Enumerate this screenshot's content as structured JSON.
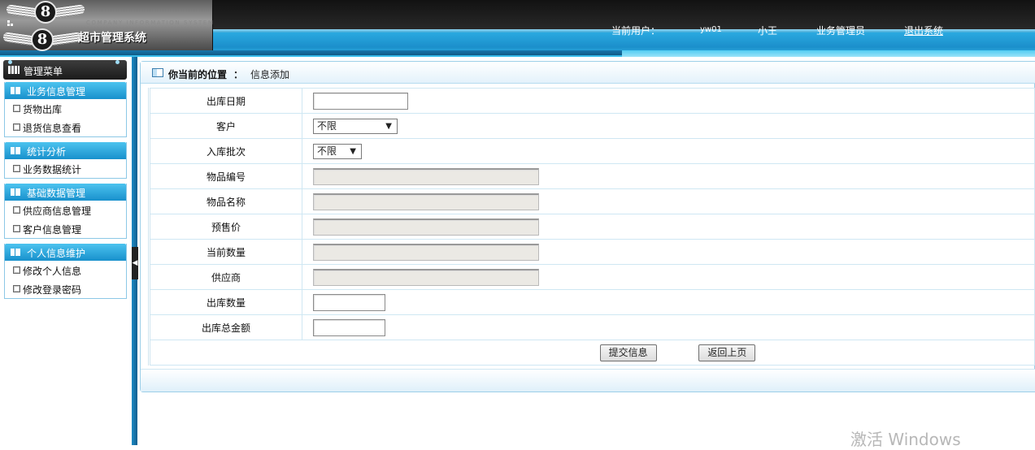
{
  "header": {
    "logo_text": "8",
    "company_en": "COMPANY INFORMATION SYSTEM",
    "app_title": "超市管理系统",
    "current_user_label": "当前用户：",
    "user_id": "yw01",
    "user_name": "小王",
    "role": "业务管理员",
    "logout": "退出系统"
  },
  "sidebar": {
    "title": "管理菜单",
    "groups": [
      {
        "title": "业务信息管理",
        "items": [
          {
            "label": "货物出库"
          },
          {
            "label": "退货信息查看"
          }
        ]
      },
      {
        "title": "统计分析",
        "items": [
          {
            "label": "业务数据统计"
          }
        ]
      },
      {
        "title": "基础数据管理",
        "items": [
          {
            "label": "供应商信息管理"
          },
          {
            "label": "客户信息管理"
          }
        ]
      },
      {
        "title": "个人信息维护",
        "items": [
          {
            "label": "修改个人信息"
          },
          {
            "label": "修改登录密码"
          }
        ]
      }
    ],
    "toggle_glyph": "◀"
  },
  "breadcrumb": {
    "label": "你当前的位置",
    "separator": "：",
    "value": "信息添加"
  },
  "form": {
    "fields": [
      {
        "label": "出库日期",
        "value": ""
      },
      {
        "label": "客户",
        "selected": "不限"
      },
      {
        "label": "入库批次",
        "selected": "不限"
      },
      {
        "label": "物品编号",
        "value": ""
      },
      {
        "label": "物品名称",
        "value": ""
      },
      {
        "label": "预售价",
        "value": ""
      },
      {
        "label": "当前数量",
        "value": ""
      },
      {
        "label": "供应商",
        "value": ""
      },
      {
        "label": "出库数量",
        "value": ""
      },
      {
        "label": "出库总金额",
        "value": ""
      }
    ],
    "submit_label": "提交信息",
    "back_label": "返回上页",
    "select_arrow": "▼"
  },
  "watermark": "激活 Windows"
}
